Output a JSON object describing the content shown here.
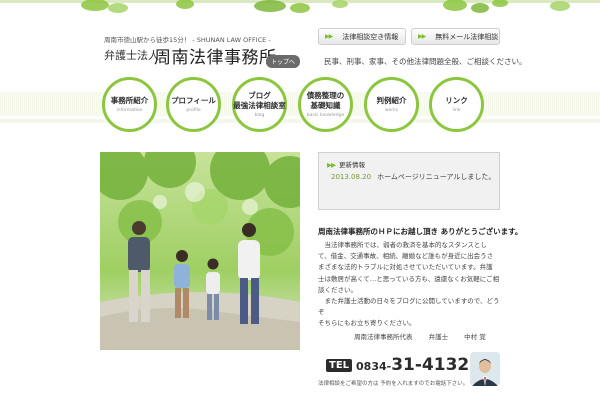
{
  "header": {
    "tagline": "周南市徳山駅から徒歩15分！ - SHUNAN LAW OFFICE -",
    "corp_type": "弁護士法人",
    "firm_name": "周南法律事務所",
    "top_badge": "トップへ",
    "btn_consult": "法律相談空き情報",
    "btn_email": "無料メール法律相談",
    "description": "民事、刑事、家事、その他法律問題全般、ご相談ください。"
  },
  "nav": [
    {
      "label": "事務所紹介",
      "sub": "information"
    },
    {
      "label": "プロフィール",
      "sub": "profile"
    },
    {
      "label_lines": [
        "ブログ",
        "最強法律相談室"
      ],
      "sub": "blog"
    },
    {
      "label_lines": [
        "債務整理の",
        "基礎知識"
      ],
      "sub": "basic knowledge"
    },
    {
      "label": "判例紹介",
      "sub": "works"
    },
    {
      "label": "リンク",
      "sub": "link"
    }
  ],
  "news": {
    "title": "更新情報",
    "items": [
      {
        "date": "2013.08.20",
        "text": "ホームページリニューアルしました。"
      }
    ]
  },
  "greeting": {
    "title": "周南法律事務所のＨＰにお越し頂き ありがとうございます。",
    "lines": [
      "　当法律事務所では、弱者の救済を基本的なスタンスとし",
      "て、借金、交通事故、相続、離婚など誰もが身近に出会うさ",
      "まざまな法的トラブルに対処させていただいています。弁護",
      "士は敷居が高くて…と思っている方も、遠慮なくお気軽にご相",
      "談ください。",
      "　また弁護士活動の日々をブログに公開していますので、どう",
      "ぞ",
      "そちらにもお立ち寄りください。"
    ],
    "sign_org": "周南法律事務所代表",
    "sign_title": "弁護士",
    "sign_name": "中村 覚"
  },
  "contact": {
    "tel_label": "TEL",
    "tel_area": "0834-",
    "tel_number": "31-4132",
    "note": "法律相談をご希望の方は 予約を入れますのでお電話下さい。"
  },
  "colors": {
    "accent_green": "#8cc63f",
    "arrow_green": "#7bbb2a",
    "news_dot": "#f5b800"
  }
}
